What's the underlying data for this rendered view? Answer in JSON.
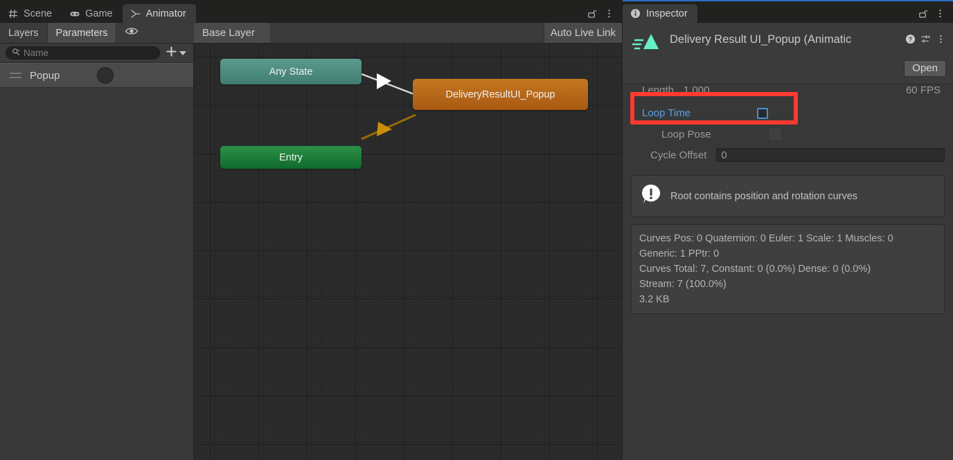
{
  "animator_window": {
    "tabs": [
      {
        "label": "Scene",
        "icon": "grid-icon",
        "active": false
      },
      {
        "label": "Game",
        "icon": "gamepad-icon",
        "active": false
      },
      {
        "label": "Animator",
        "icon": "animator-icon",
        "active": true
      }
    ],
    "tab_actions": {
      "lock": "lock-open-icon",
      "menu": "kebab-menu-icon"
    },
    "side_tabs": [
      {
        "label": "Layers",
        "selected": false
      },
      {
        "label": "Parameters",
        "selected": true
      }
    ],
    "visibility_icon": "eye-icon",
    "breadcrumb": "Base Layer",
    "auto_live_link": "Auto Live Link",
    "search": {
      "placeholder": "Name",
      "value": "",
      "icon": "search-icon"
    },
    "add_button": {
      "label": "+",
      "icon": "plus-icon",
      "caret": "chevron-down-icon"
    },
    "layers": [
      {
        "name": "Popup",
        "weight_icon": "blend-circle-icon"
      }
    ],
    "graph": {
      "nodes": [
        {
          "id": "any-state",
          "label": "Any State",
          "kind": "any"
        },
        {
          "id": "entry",
          "label": "Entry",
          "kind": "entry"
        },
        {
          "id": "delivery-result",
          "label": "DeliveryResultUI_Popup",
          "kind": "state"
        }
      ],
      "transitions": [
        {
          "from": "any-state",
          "to": "delivery-result",
          "color": "#d8d8d8"
        },
        {
          "from": "entry",
          "to": "delivery-result",
          "color": "#9a6a08"
        }
      ]
    }
  },
  "inspector": {
    "tab": {
      "label": "Inspector",
      "icon": "info-icon"
    },
    "tab_actions": {
      "lock": "lock-open-icon",
      "menu": "kebab-menu-icon"
    },
    "asset_title": "Delivery Result UI_Popup (Animatic",
    "asset_icon": "animation-clip-icon",
    "header_icons": {
      "help": "help-icon",
      "preset": "preset-icon",
      "menu": "kebab-menu-icon"
    },
    "open_button": "Open",
    "fields": {
      "length_label": "Length",
      "length_value": "1.000",
      "fps": "60 FPS",
      "loop_time_label": "Loop Time",
      "loop_time_checked": false,
      "loop_pose_label": "Loop Pose",
      "loop_pose_checked": false,
      "cycle_offset_label": "Cycle Offset",
      "cycle_offset_value": "0"
    },
    "help_message": "Root contains position and rotation curves",
    "help_icon": "warning-bubble-icon",
    "stats": [
      "Curves Pos: 0 Quaternion: 0 Euler: 1 Scale: 1 Muscles: 0",
      "Generic: 1 PPtr: 0",
      "Curves Total: 7, Constant: 0 (0.0%) Dense: 0 (0.0%)",
      "Stream: 7 (100.0%)",
      "3.2 KB"
    ]
  },
  "annotation": {
    "highlight_color": "#ff3a30",
    "highlight_target": "loop-time-field"
  },
  "colors": {
    "accent_blue": "#5aa0ea",
    "any_state": "#4f8a7e",
    "entry": "#1b7d37",
    "state": "#b8681a",
    "clip_icon": "#66f0c8"
  }
}
